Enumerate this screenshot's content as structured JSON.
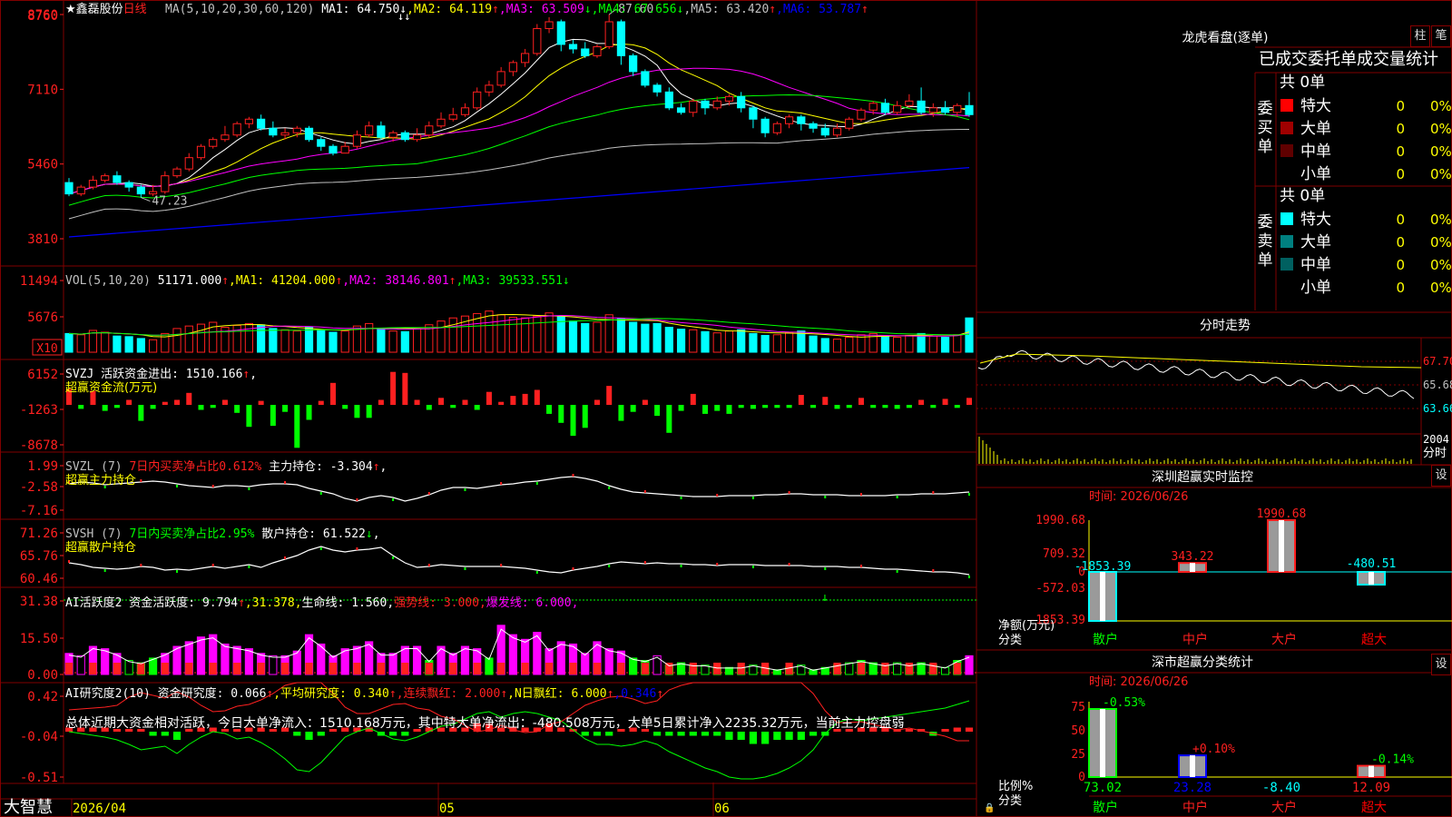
{
  "app": {
    "brand": "大智慧",
    "star": "★",
    "stock": "鑫磊股份",
    "period": "日线"
  },
  "colors": {
    "up": "#ff2020",
    "down": "#00ffff",
    "ma1": "#ffffff",
    "ma2": "#ffff00",
    "ma3": "#ff00ff",
    "ma4": "#00ff00",
    "ma5": "#c0c0c0",
    "ma6": "#0000ff",
    "grid": "#800000"
  },
  "main": {
    "ma_header": [
      {
        "t": "MA(5,10,20,30,60,120)",
        "c": "#c0c0c0"
      },
      {
        "t": " MA1: 64.750",
        "c": "#ffffff"
      },
      {
        "t": "↓",
        "c": "#ffffff"
      },
      {
        "t": ",MA2: 64.119",
        "c": "#ffff00"
      },
      {
        "t": "↑",
        "c": "#ff2020"
      },
      {
        "t": ",MA3: 63.509",
        "c": "#ff00ff"
      },
      {
        "t": "↓",
        "c": "#00ff00"
      },
      {
        "t": ",MA4: 67.656",
        "c": "#00ff00"
      },
      {
        "t": "↓",
        "c": "#00ff00"
      },
      {
        "t": ",MA5: 63.420",
        "c": "#c0c0c0"
      },
      {
        "t": "↑",
        "c": "#ff2020"
      },
      {
        "t": ",MA6: 53.787",
        "c": "#0000ff"
      },
      {
        "t": "↑",
        "c": "#ff2020"
      }
    ],
    "y_ticks": [
      "8760",
      "7110",
      "5460",
      "3810"
    ],
    "high_label": "87.60",
    "low_label": "47.23",
    "x_labels": [
      "2026/04",
      "05",
      "06"
    ],
    "candles": [
      [
        50.5,
        48.0,
        51.5,
        47.5
      ],
      [
        48.0,
        49.5,
        50.0,
        47.5
      ],
      [
        49.5,
        51.0,
        52.0,
        49.0
      ],
      [
        51.0,
        52.0,
        52.5,
        50.5
      ],
      [
        52.0,
        50.5,
        53.0,
        50.0
      ],
      [
        50.5,
        49.5,
        51.0,
        48.5
      ],
      [
        49.5,
        48.0,
        50.0,
        47.2
      ],
      [
        48.0,
        48.5,
        50.0,
        47.5
      ],
      [
        48.5,
        52.0,
        53.0,
        48.0
      ],
      [
        52.0,
        53.5,
        54.0,
        51.5
      ],
      [
        53.5,
        56.0,
        57.0,
        53.0
      ],
      [
        56.0,
        58.5,
        59.0,
        55.5
      ],
      [
        58.5,
        60.0,
        60.5,
        58.0
      ],
      [
        60.0,
        61.0,
        63.0,
        59.5
      ],
      [
        61.0,
        63.5,
        64.0,
        60.5
      ],
      [
        63.5,
        64.5,
        65.0,
        62.5
      ],
      [
        64.5,
        62.5,
        65.5,
        62.0
      ],
      [
        62.5,
        61.0,
        64.0,
        60.5
      ],
      [
        61.0,
        61.5,
        62.5,
        60.0
      ],
      [
        61.5,
        62.5,
        63.0,
        60.5
      ],
      [
        62.5,
        60.0,
        63.0,
        59.5
      ],
      [
        60.0,
        58.5,
        60.5,
        57.5
      ],
      [
        58.5,
        57.0,
        59.0,
        56.5
      ],
      [
        57.0,
        58.5,
        59.5,
        57.0
      ],
      [
        58.5,
        61.0,
        62.0,
        58.0
      ],
      [
        61.0,
        63.0,
        64.0,
        60.5
      ],
      [
        63.0,
        60.5,
        64.0,
        60.0
      ],
      [
        60.5,
        61.5,
        62.0,
        59.5
      ],
      [
        61.5,
        60.0,
        62.0,
        59.5
      ],
      [
        60.0,
        61.0,
        62.5,
        59.5
      ],
      [
        61.0,
        63.0,
        64.0,
        60.5
      ],
      [
        63.0,
        64.5,
        66.0,
        62.5
      ],
      [
        64.5,
        65.5,
        67.0,
        64.0
      ],
      [
        65.5,
        67.0,
        68.0,
        65.0
      ],
      [
        67.0,
        70.5,
        71.5,
        66.5
      ],
      [
        70.5,
        72.0,
        73.0,
        69.5
      ],
      [
        72.0,
        75.0,
        76.0,
        71.5
      ],
      [
        75.0,
        77.0,
        77.5,
        74.0
      ],
      [
        77.0,
        79.0,
        80.0,
        76.0
      ],
      [
        79.0,
        84.5,
        85.5,
        78.5
      ],
      [
        84.5,
        86.0,
        87.0,
        83.5
      ],
      [
        86.0,
        81.0,
        86.5,
        79.5
      ],
      [
        81.0,
        80.0,
        82.0,
        79.0
      ],
      [
        80.0,
        78.5,
        81.5,
        78.0
      ],
      [
        78.5,
        80.5,
        81.0,
        78.0
      ],
      [
        80.5,
        86.0,
        87.6,
        80.0
      ],
      [
        86.0,
        78.5,
        86.5,
        76.5
      ],
      [
        78.5,
        75.0,
        79.0,
        74.0
      ],
      [
        75.0,
        72.0,
        75.5,
        71.5
      ],
      [
        72.0,
        70.5,
        72.5,
        69.5
      ],
      [
        70.5,
        67.0,
        71.5,
        66.5
      ],
      [
        67.0,
        66.0,
        68.0,
        65.5
      ],
      [
        66.0,
        68.5,
        69.0,
        65.0
      ],
      [
        68.5,
        67.0,
        69.0,
        65.5
      ],
      [
        67.0,
        68.5,
        69.5,
        66.5
      ],
      [
        68.5,
        69.5,
        70.0,
        67.5
      ],
      [
        69.5,
        67.0,
        70.5,
        66.0
      ],
      [
        67.0,
        64.5,
        67.5,
        62.5
      ],
      [
        64.5,
        61.5,
        65.0,
        60.5
      ],
      [
        61.5,
        63.5,
        64.0,
        61.0
      ],
      [
        63.5,
        65.0,
        65.5,
        62.5
      ],
      [
        65.0,
        63.5,
        65.5,
        62.0
      ],
      [
        63.5,
        62.5,
        64.0,
        61.5
      ],
      [
        62.5,
        61.0,
        63.5,
        60.5
      ],
      [
        61.0,
        62.5,
        63.5,
        60.5
      ],
      [
        62.5,
        64.5,
        65.0,
        62.0
      ],
      [
        64.5,
        66.5,
        67.0,
        64.0
      ],
      [
        66.5,
        68.0,
        68.5,
        65.5
      ],
      [
        68.0,
        66.0,
        69.0,
        65.5
      ],
      [
        66.0,
        67.5,
        68.5,
        65.5
      ],
      [
        67.5,
        68.5,
        70.0,
        67.0
      ],
      [
        68.5,
        66.0,
        71.5,
        65.5
      ],
      [
        66.0,
        67.0,
        68.0,
        65.0
      ],
      [
        67.0,
        66.0,
        68.5,
        65.5
      ],
      [
        66.0,
        67.5,
        68.0,
        65.0
      ],
      [
        67.5,
        65.5,
        70.5,
        65.0
      ]
    ]
  },
  "vol": {
    "header": [
      {
        "t": "VOL(5,10,20)",
        "c": "#c0c0c0"
      },
      {
        "t": " 51171.000",
        "c": "#ffffff"
      },
      {
        "t": "↑",
        "c": "#ff2020"
      },
      {
        "t": ",MA1: 41204.000",
        "c": "#ffff00"
      },
      {
        "t": "↑",
        "c": "#ff2020"
      },
      {
        "t": ",MA2: 38146.801",
        "c": "#ff00ff"
      },
      {
        "t": "↑",
        "c": "#ff2020"
      },
      {
        "t": ",MA3: 39533.551",
        "c": "#00ff00"
      },
      {
        "t": "↓",
        "c": "#00ff00"
      }
    ],
    "y_ticks": [
      "11494",
      "5676"
    ],
    "mult": "X10"
  },
  "svzj": {
    "header": [
      {
        "t": "SVZJ  活跃资金进出: 1510.166",
        "c": "#ffffff"
      },
      {
        "t": "↑",
        "c": "#ff2020"
      },
      {
        "t": ",",
        "c": "#ffffff"
      }
    ],
    "sub": "超赢资金流(万元)",
    "y_ticks": [
      "6152",
      "-1263",
      "-8678"
    ]
  },
  "svzl": {
    "header": [
      {
        "t": "SVZL (7) ",
        "c": "#c0c0c0"
      },
      {
        "t": "7日内买卖净占比0.612%",
        "c": "#ff2020"
      },
      {
        "t": " 主力持仓: -3.304",
        "c": "#ffffff"
      },
      {
        "t": "↑",
        "c": "#ff2020"
      },
      {
        "t": ",",
        "c": "#ffffff"
      }
    ],
    "sub": "超赢主力持仓",
    "y_ticks": [
      "1.99",
      "-2.58",
      "-7.16"
    ]
  },
  "svsh": {
    "header": [
      {
        "t": "SVSH (7) ",
        "c": "#c0c0c0"
      },
      {
        "t": "7日内买卖净占比2.95%",
        "c": "#00ff00"
      },
      {
        "t": " 散户持仓: 61.522",
        "c": "#ffffff"
      },
      {
        "t": "↓",
        "c": "#00ff00"
      },
      {
        "t": ",",
        "c": "#ffffff"
      }
    ],
    "sub": "超赢散户持仓",
    "y_ticks": [
      "71.26",
      "65.76",
      "60.46"
    ]
  },
  "ai2": {
    "header": [
      {
        "t": "AI活跃度2 资金活跃度: 9.794",
        "c": "#ffffff"
      },
      {
        "t": "↑",
        "c": "#ff2020"
      },
      {
        "t": ",31.378,",
        "c": "#ffff00"
      },
      {
        "t": "生命线: 1.560,",
        "c": "#ffffff"
      },
      {
        "t": "强势线: 3.000,",
        "c": "#ff2020"
      },
      {
        "t": "爆发线: 6.000,",
        "c": "#ff00ff"
      }
    ],
    "y_ticks": [
      "31.38",
      "15.50",
      "0.00"
    ]
  },
  "ai3": {
    "header": [
      {
        "t": "AI研究度2(10) 资金研究度: 0.066",
        "c": "#ffffff"
      },
      {
        "t": "↑",
        "c": "#ff2020"
      },
      {
        "t": ",平均研究度: 0.340",
        "c": "#ffff00"
      },
      {
        "t": "↑",
        "c": "#ff2020"
      },
      {
        "t": ",连续飘红: 2.000",
        "c": "#ff2020"
      },
      {
        "t": "↑",
        "c": "#ff2020"
      },
      {
        "t": ",N日飘红: 6.000",
        "c": "#ffff00"
      },
      {
        "t": "↑",
        "c": "#ff2020"
      },
      {
        "t": ",0.346",
        "c": "#0000ff"
      },
      {
        "t": "↑",
        "c": "#ff2020"
      }
    ],
    "summary": "总体近期大资金相对活跃，今日大单净流入：1510.168万元，其中特大单净流出：-480.508万元，大单5日累计净入2235.32万元，当前主力控盘弱",
    "y_ticks": [
      "0.42",
      "-0.04",
      "-0.51"
    ]
  },
  "right": {
    "longhu_title": "龙虎看盘(逐单)",
    "btn_zhu": "柱",
    "btn_bi": "笔",
    "stat_title": "已成交委托单成交量统计",
    "buy_label": [
      "委",
      "买",
      "单"
    ],
    "sell_label": [
      "委",
      "卖",
      "单"
    ],
    "buy_total": "共 0单",
    "sell_total": "共 0单",
    "buy_rows": [
      {
        "name": "特大",
        "val": "0",
        "pct": "0%",
        "color": "#ff0000"
      },
      {
        "name": "大单",
        "val": "0",
        "pct": "0%",
        "color": "#a00000"
      },
      {
        "name": "中单",
        "val": "0",
        "pct": "0%",
        "color": "#600000"
      },
      {
        "name": "小单",
        "val": "0",
        "pct": "0%",
        "color": "#000000"
      }
    ],
    "sell_rows": [
      {
        "name": "特大",
        "val": "0",
        "pct": "0%",
        "color": "#00ffff"
      },
      {
        "name": "大单",
        "val": "0",
        "pct": "0%",
        "color": "#008080"
      },
      {
        "name": "中单",
        "val": "0",
        "pct": "0%",
        "color": "#006060"
      },
      {
        "name": "小单",
        "val": "0",
        "pct": "0%",
        "color": "#000000"
      }
    ],
    "fenshi_title": "分时走势",
    "fenshi_ticks": [
      "67.70",
      "65.68",
      "63.66",
      "2004"
    ],
    "fenshi_unit": "分时",
    "sz_monitor_title": "深圳超赢实时监控",
    "monitor_time": "时间: 2026/06/26",
    "monitor_ticks": [
      "1990.68",
      "709.32",
      "0",
      "-572.03",
      "-1853.39"
    ],
    "monitor_axis": [
      "净额(万元)",
      "分类"
    ],
    "monitor_cats": [
      "散户",
      "中户",
      "大户",
      "超大"
    ],
    "monitor_vals": [
      -1853.39,
      343.22,
      1990.68,
      -480.51
    ],
    "monitor_val_labels": [
      "-1853.39",
      "343.22",
      "1990.68",
      "-480.51"
    ],
    "set_btn": "设",
    "cls_title": "深市超赢分类统计",
    "cls_time": "时间: 2026/06/26",
    "cls_ticks": [
      "75",
      "50",
      "25",
      "0"
    ],
    "cls_axis": [
      "比例%",
      "分类"
    ],
    "cls_cats": [
      "散户",
      "中户",
      "大户",
      "超大"
    ],
    "cls_vals": [
      73.02,
      23.28,
      -8.4,
      12.09
    ],
    "cls_val_labels": [
      "73.02",
      "23.28",
      "-8.40",
      "12.09"
    ],
    "cls_chg": [
      "-0.53%",
      "+0.10%",
      "",
      "-0.14%"
    ]
  },
  "chart_data": [
    {
      "type": "bar",
      "title": "深圳超赢实时监控",
      "ylabel": "净额(万元)",
      "xlabel": "分类",
      "categories": [
        "散户",
        "中户",
        "大户",
        "超大"
      ],
      "values": [
        -1853.39,
        343.22,
        1990.68,
        -480.51
      ],
      "ylim": [
        -1853.39,
        1990.68
      ]
    },
    {
      "type": "bar",
      "title": "深市超赢分类统计",
      "ylabel": "比例%",
      "xlabel": "分类",
      "categories": [
        "散户",
        "中户",
        "大户",
        "超大"
      ],
      "values": [
        73.02,
        23.28,
        -8.4,
        12.09
      ],
      "ylim": [
        0,
        75
      ]
    }
  ]
}
